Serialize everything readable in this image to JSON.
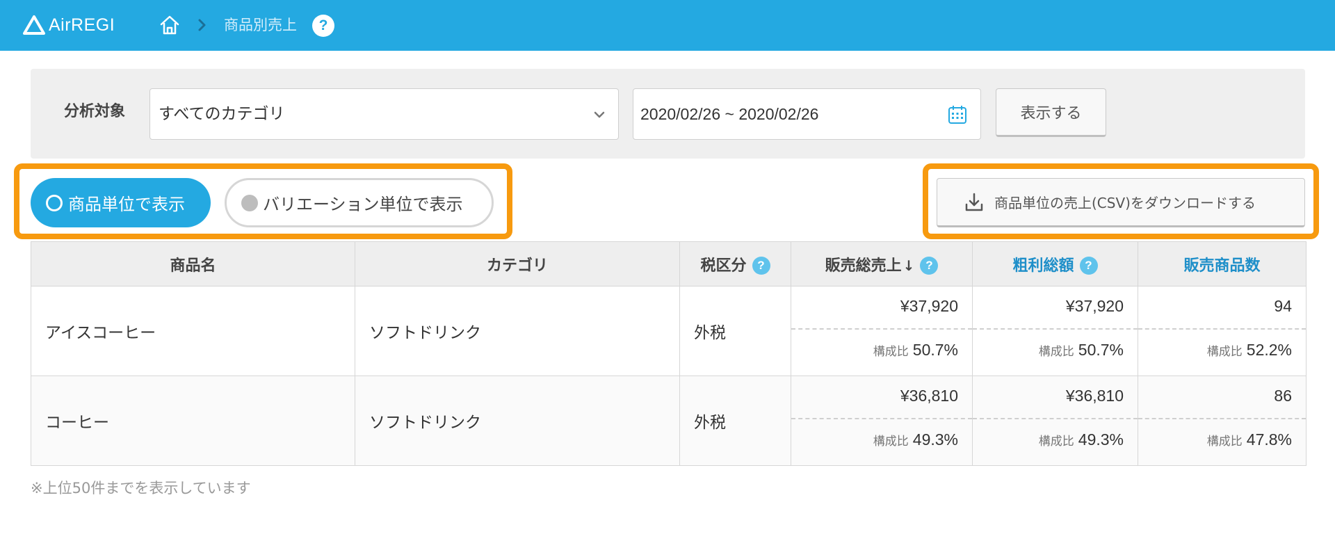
{
  "header": {
    "logo_text": "AirREGI",
    "breadcrumb": "商品別売上",
    "help_glyph": "?"
  },
  "filter": {
    "label": "分析対象",
    "category_value": "すべてのカテゴリ",
    "date_range": "2020/02/26 ~ 2020/02/26",
    "show_button": "表示する"
  },
  "view_toggle": {
    "product_unit": "商品単位で表示",
    "variation_unit": "バリエーション単位で表示"
  },
  "csv_button": "商品単位の売上(CSV)をダウンロードする",
  "table": {
    "columns": {
      "product": "商品名",
      "category": "カテゴリ",
      "tax": "税区分",
      "total_sales": "販売総売上",
      "sort_arrow": "↓",
      "gross_profit": "粗利総額",
      "quantity": "販売商品数"
    },
    "ratio_label": "構成比",
    "rows": [
      {
        "product": "アイスコーヒー",
        "category": "ソフトドリンク",
        "tax": "外税",
        "sales": "¥37,920",
        "sales_ratio": "50.7%",
        "profit": "¥37,920",
        "profit_ratio": "50.7%",
        "qty": "94",
        "qty_ratio": "52.2%"
      },
      {
        "product": "コーヒー",
        "category": "ソフトドリンク",
        "tax": "外税",
        "sales": "¥36,810",
        "sales_ratio": "49.3%",
        "profit": "¥36,810",
        "profit_ratio": "49.3%",
        "qty": "86",
        "qty_ratio": "47.8%"
      }
    ]
  },
  "footnote": "※上位50件までを表示しています",
  "colors": {
    "brand": "#24a9e1",
    "highlight": "#f79a0f",
    "link_header": "#1f8fc9"
  },
  "icons": [
    "home-icon",
    "chevron-right-icon",
    "help-icon",
    "chevron-down-icon",
    "calendar-icon",
    "download-icon",
    "radio-icon"
  ]
}
